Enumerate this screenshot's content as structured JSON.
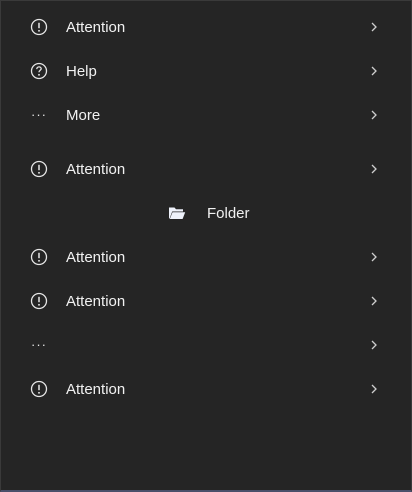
{
  "menu": {
    "items": [
      {
        "label": "Attention",
        "icon": "exclamation-circle-icon"
      },
      {
        "label": "Help",
        "icon": "question-circle-icon"
      },
      {
        "label": "More",
        "icon": "ellipsis-icon"
      },
      {
        "label": "Attention",
        "icon": "exclamation-circle-icon"
      },
      {
        "label": "Folder",
        "icon": "folder-open-icon"
      },
      {
        "label": "Attention",
        "icon": "exclamation-circle-icon"
      },
      {
        "label": "Attention",
        "icon": "exclamation-circle-icon"
      },
      {
        "label": "",
        "icon": "ellipsis-icon"
      },
      {
        "label": "Attention",
        "icon": "exclamation-circle-icon"
      }
    ],
    "dots_glyph": "···"
  }
}
